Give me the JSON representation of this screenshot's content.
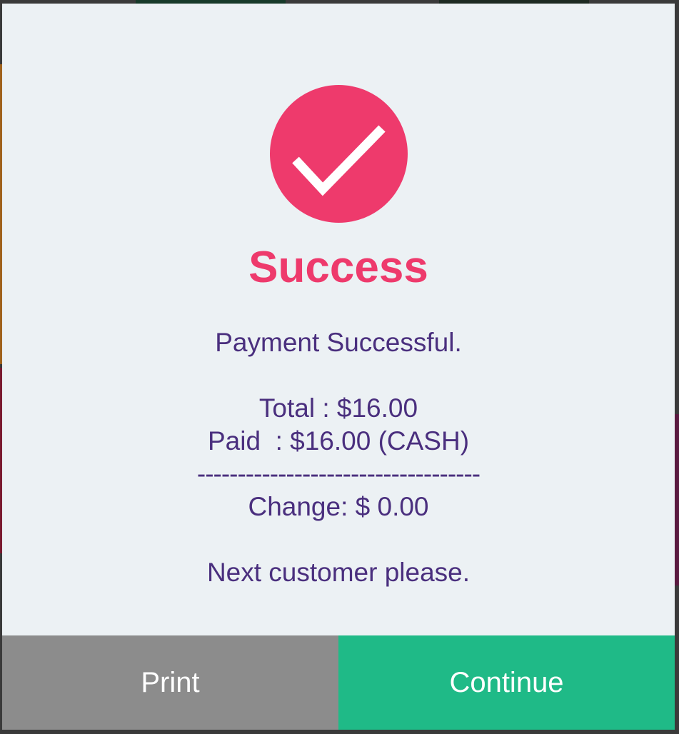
{
  "colors": {
    "accent": "#ee3a6c",
    "text": "#4a2f7e",
    "modal_background": "#ecf1f4",
    "print_button": "#8c8c8c",
    "continue_button": "#1fba87"
  },
  "dialog": {
    "icon": "checkmark-icon",
    "title": "Success",
    "message_lines": [
      "Payment Successful.",
      "",
      "Total : $16.00",
      "Paid  : $16.00 (CASH)",
      "-----------------------------------",
      "Change: $ 0.00",
      "",
      "Next customer please."
    ]
  },
  "buttons": {
    "print_label": "Print",
    "continue_label": "Continue"
  }
}
